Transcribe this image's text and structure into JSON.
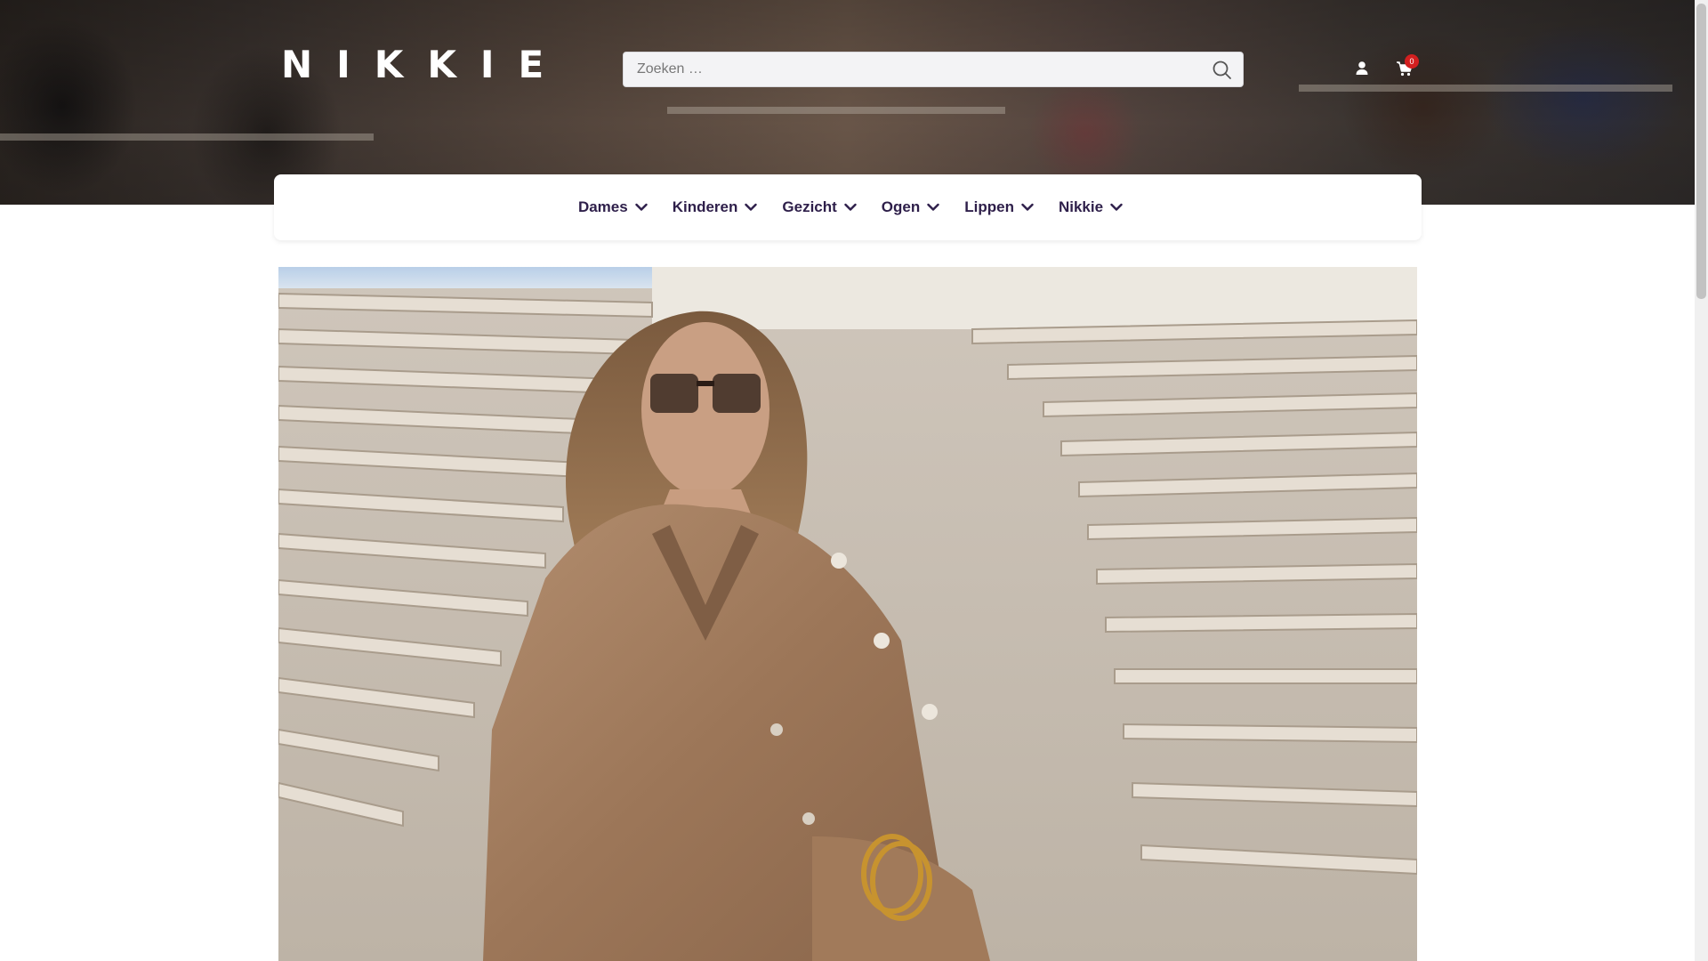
{
  "brand": {
    "logo_text": "NIKKIE"
  },
  "search": {
    "placeholder": "Zoeken …",
    "icon": "search-icon"
  },
  "header_icons": {
    "account_icon": "user-icon",
    "cart_icon": "shopping-cart-icon",
    "cart_count": "0"
  },
  "nav": {
    "items": [
      {
        "label": "Dames"
      },
      {
        "label": "Kinderen"
      },
      {
        "label": "Gezicht"
      },
      {
        "label": "Ogen"
      },
      {
        "label": "Lippen"
      },
      {
        "label": "Nikkie"
      }
    ],
    "dropdown_icon": "chevron-down-icon"
  },
  "hero": {
    "image": "model-in-camel-outfit-on-stone-steps"
  },
  "colors": {
    "nav_text": "#2e1f4a",
    "badge": "#d21f1f",
    "search_bg": "#f3f3f5"
  }
}
